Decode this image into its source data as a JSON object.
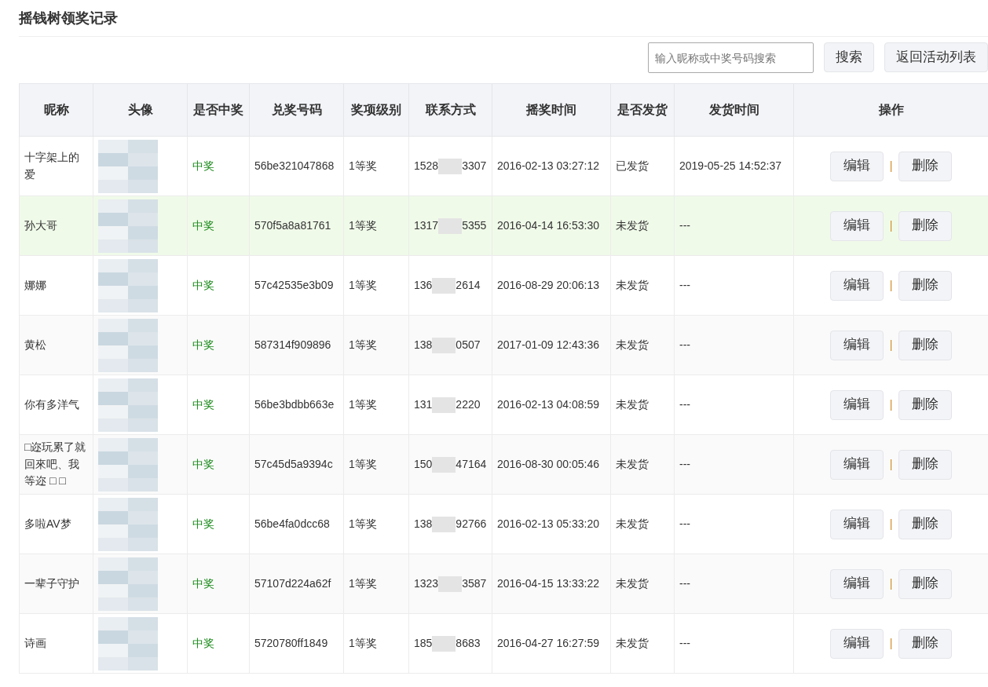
{
  "page": {
    "title": "摇钱树领奖记录"
  },
  "search": {
    "placeholder": "输入昵称或中奖号码搜索",
    "buttons": [
      "搜索",
      "返回活动列表"
    ]
  },
  "table": {
    "columns": [
      "昵称",
      "头像",
      "是否中奖",
      "兑奖号码",
      "奖项级别",
      "联系方式",
      "摇奖时间",
      "是否发货",
      "发货时间",
      "操作"
    ],
    "rows": [
      {
        "selected": false,
        "nickname": "十字架上的爱",
        "won": true,
        "result": "中奖",
        "code": "56be321047868",
        "level": "1等奖",
        "phone_start": "1528",
        "phone_end": "3307",
        "draw_time": "2016-02-13 03:27:12",
        "shipping": "已发货",
        "ship_time": "2019-05-25 14:52:37",
        "actions": [
          "编辑",
          "删除"
        ],
        "separator": "|"
      },
      {
        "selected": true,
        "nickname": "孙大哥",
        "won": true,
        "result": "中奖",
        "code": "570f5a8a81761",
        "level": "1等奖",
        "phone_start": "1317",
        "phone_end": "5355",
        "draw_time": "2016-04-14 16:53:30",
        "shipping": "未发货",
        "ship_time": "---",
        "actions": [
          "编辑",
          "删除"
        ],
        "separator": "|"
      },
      {
        "selected": false,
        "nickname": "娜娜",
        "won": true,
        "result": "中奖",
        "code": "57c42535e3b09",
        "level": "1等奖",
        "phone_start": "136",
        "phone_end": "2614",
        "draw_time": "2016-08-29 20:06:13",
        "shipping": "未发货",
        "ship_time": "---",
        "actions": [
          "编辑",
          "删除"
        ],
        "separator": "|"
      },
      {
        "selected": false,
        "nickname": "黄松",
        "won": true,
        "result": "中奖",
        "code": "587314f909896",
        "level": "1等奖",
        "phone_start": "138",
        "phone_end": "0507",
        "draw_time": "2017-01-09 12:43:36",
        "shipping": "未发货",
        "ship_time": "---",
        "actions": [
          "编辑",
          "删除"
        ],
        "separator": "|"
      },
      {
        "selected": false,
        "nickname": "你有多洋气",
        "won": true,
        "result": "中奖",
        "code": "56be3bdbb663e",
        "level": "1等奖",
        "phone_start": "131",
        "phone_end": "2220",
        "draw_time": "2016-02-13 04:08:59",
        "shipping": "未发货",
        "ship_time": "---",
        "actions": [
          "编辑",
          "删除"
        ],
        "separator": "|"
      },
      {
        "selected": false,
        "nickname": "□迩玩累了就回來吧、我等迩 □ □",
        "won": true,
        "result": "中奖",
        "code": "57c45d5a9394c",
        "level": "1等奖",
        "phone_start": "150",
        "phone_end": "47164",
        "draw_time": "2016-08-30 00:05:46",
        "shipping": "未发货",
        "ship_time": "---",
        "actions": [
          "编辑",
          "删除"
        ],
        "separator": "|"
      },
      {
        "selected": false,
        "nickname": "多啦AV梦",
        "won": true,
        "result": "中奖",
        "code": "56be4fa0dcc68",
        "level": "1等奖",
        "phone_start": "138",
        "phone_end": "92766",
        "draw_time": "2016-02-13 05:33:20",
        "shipping": "未发货",
        "ship_time": "---",
        "actions": [
          "编辑",
          "删除"
        ],
        "separator": "|"
      },
      {
        "selected": false,
        "nickname": "一辈子守护",
        "won": true,
        "result": "中奖",
        "code": "57107d224a62f",
        "level": "1等奖",
        "phone_start": "1323",
        "phone_end": "3587",
        "draw_time": "2016-04-15 13:33:22",
        "shipping": "未发货",
        "ship_time": "---",
        "actions": [
          "编辑",
          "删除"
        ],
        "separator": "|"
      },
      {
        "selected": false,
        "nickname": "诗画",
        "won": true,
        "result": "中奖",
        "code": "5720780ff1849",
        "level": "1等奖",
        "phone_start": "185",
        "phone_end": "8683",
        "draw_time": "2016-04-27 16:27:59",
        "shipping": "未发货",
        "ship_time": "---",
        "actions": [
          "编辑",
          "删除"
        ],
        "separator": "|"
      }
    ]
  }
}
